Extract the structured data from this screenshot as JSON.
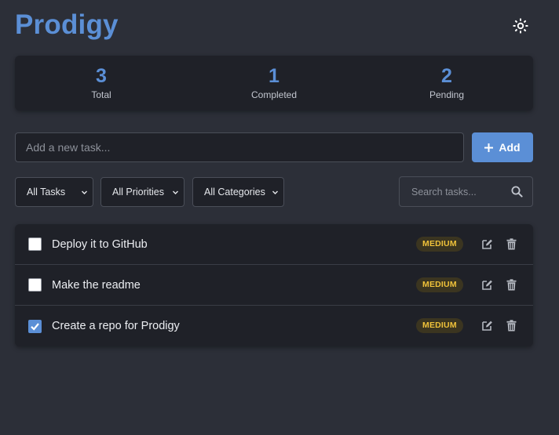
{
  "header": {
    "title": "Prodigy",
    "theme_icon": "sun-icon"
  },
  "stats": [
    {
      "value": "3",
      "label": "Total"
    },
    {
      "value": "1",
      "label": "Completed"
    },
    {
      "value": "2",
      "label": "Pending"
    }
  ],
  "add_task": {
    "placeholder": "Add a new task...",
    "value": "",
    "button_label": "Add",
    "button_icon": "plus-icon"
  },
  "filters": {
    "status": "All Tasks",
    "priority": "All Priorities",
    "category": "All Categories",
    "search_placeholder": "Search tasks...",
    "search_value": ""
  },
  "tasks": [
    {
      "text": "Deploy it to GitHub",
      "priority": "MEDIUM",
      "completed": false
    },
    {
      "text": "Make the readme",
      "priority": "MEDIUM",
      "completed": false
    },
    {
      "text": "Create a repo for Prodigy",
      "priority": "MEDIUM",
      "completed": true
    }
  ],
  "colors": {
    "accent": "#5b8fd6",
    "background": "#2c2f38",
    "panel": "#1f2128",
    "badge_medium_text": "#f0c23a",
    "badge_medium_bg": "#3b3520"
  }
}
